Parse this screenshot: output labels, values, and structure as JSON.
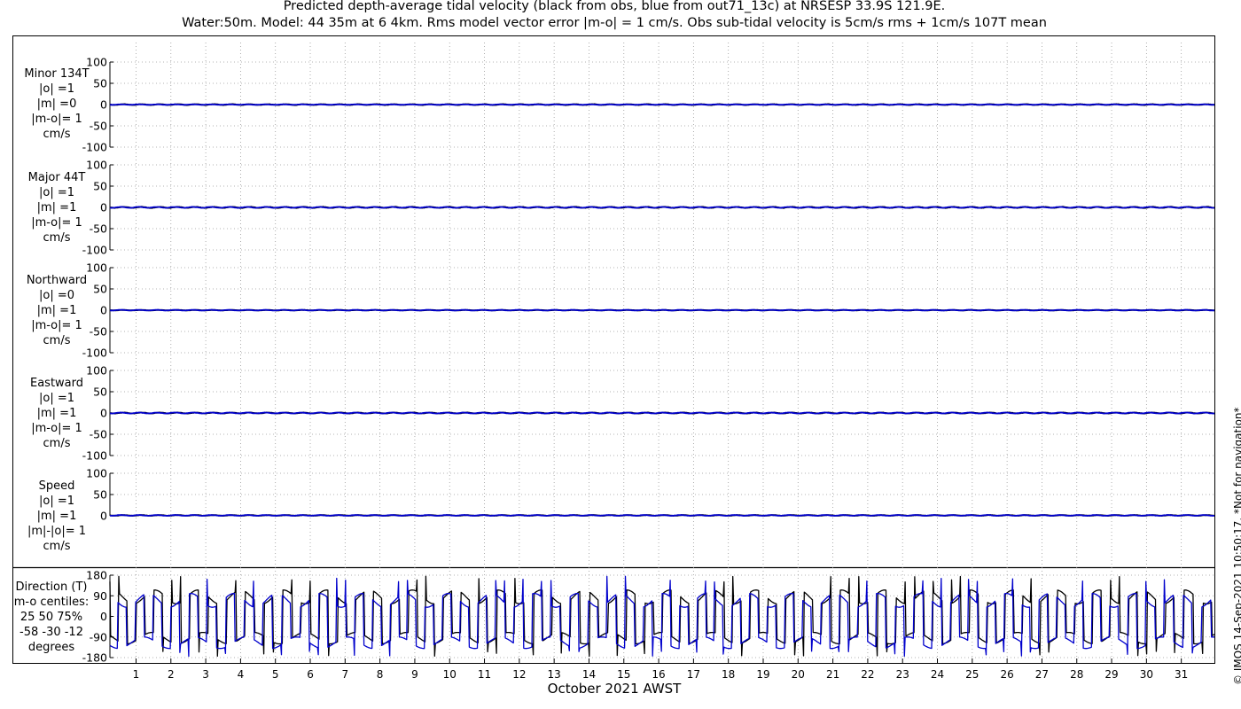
{
  "figure": {
    "title_line1": "Predicted depth-average tidal velocity (black from obs, blue from out71_13c) at NRSESP 33.9S 121.9E.",
    "title_line2": "Water:50m. Model: 44 35m at 6 4km. Rms model vector error |m-o| = 1 cm/s. Obs sub-tidal velocity is 5cm/s rms + 1cm/s 107T mean",
    "xlabel": "October 2021 AWST",
    "credit": "© IMOS 14-Sep-2021 10:50:17. *Not for navigation*",
    "colors": {
      "obs": "#000000",
      "model": "#0000cc"
    }
  },
  "panels": [
    {
      "label_lines": [
        "Minor 134T",
        "|o| =1",
        "|m| =0",
        "|m-o|= 1",
        "cm/s"
      ]
    },
    {
      "label_lines": [
        "Major 44T",
        "|o| =1",
        "|m| =1",
        "|m-o|= 1",
        "cm/s"
      ]
    },
    {
      "label_lines": [
        "Northward",
        "|o| =0",
        "|m| =1",
        "|m-o|= 1",
        "cm/s"
      ]
    },
    {
      "label_lines": [
        "Eastward",
        "|o| =1",
        "|m| =1",
        "|m-o|= 1",
        "cm/s"
      ]
    },
    {
      "label_lines": [
        "Speed",
        "|o| =1",
        "|m| =1",
        "|m|-|o|= 1",
        "cm/s"
      ]
    },
    {
      "label_lines": [
        "Direction (T)",
        "m-o centiles:",
        "25  50  75%",
        "-58 -30 -12",
        "degrees"
      ]
    }
  ],
  "chart_data": [
    {
      "type": "line",
      "title": "Minor 134T",
      "ylabel": "cm/s",
      "ylim": [
        -100,
        100
      ],
      "yticks": [
        -100,
        -50,
        0,
        50,
        100
      ],
      "xlim": [
        0.25,
        31.95
      ],
      "series": [
        {
          "name": "obs",
          "amplitude": 1.0,
          "mean": 0
        },
        {
          "name": "model",
          "amplitude": 0.5,
          "mean": 0
        }
      ]
    },
    {
      "type": "line",
      "title": "Major 44T",
      "ylabel": "cm/s",
      "ylim": [
        -100,
        100
      ],
      "yticks": [
        -100,
        -50,
        0,
        50,
        100
      ],
      "xlim": [
        0.25,
        31.95
      ],
      "series": [
        {
          "name": "obs",
          "amplitude": 1.2,
          "mean": 0
        },
        {
          "name": "model",
          "amplitude": 1.0,
          "mean": 0
        }
      ]
    },
    {
      "type": "line",
      "title": "Northward",
      "ylabel": "cm/s",
      "ylim": [
        -100,
        100
      ],
      "yticks": [
        -100,
        -50,
        0,
        50,
        100
      ],
      "xlim": [
        0.25,
        31.95
      ],
      "series": [
        {
          "name": "obs",
          "amplitude": 0.5,
          "mean": 0
        },
        {
          "name": "model",
          "amplitude": 0.8,
          "mean": 0
        }
      ]
    },
    {
      "type": "line",
      "title": "Eastward",
      "ylabel": "cm/s",
      "ylim": [
        -100,
        100
      ],
      "yticks": [
        -100,
        -50,
        0,
        50,
        100
      ],
      "xlim": [
        0.25,
        31.95
      ],
      "series": [
        {
          "name": "obs",
          "amplitude": 1.0,
          "mean": 0
        },
        {
          "name": "model",
          "amplitude": 1.0,
          "mean": 0
        }
      ]
    },
    {
      "type": "line",
      "title": "Speed",
      "ylabel": "cm/s",
      "ylim": [
        -100,
        100
      ],
      "yticks": [
        0,
        50,
        100
      ],
      "xlim": [
        0.25,
        31.95
      ],
      "series": [
        {
          "name": "obs",
          "amplitude": 0.8,
          "mean": 1
        },
        {
          "name": "model",
          "amplitude": 0.8,
          "mean": 1
        }
      ]
    },
    {
      "type": "line",
      "title": "Direction (T)",
      "ylabel": "degrees",
      "ylim": [
        -180,
        180
      ],
      "yticks": [
        -180,
        -90,
        0,
        90,
        180
      ],
      "xlim": [
        0.25,
        31.95
      ],
      "series": [
        {
          "name": "obs",
          "flood_dir": 85,
          "ebb_dir": -95
        },
        {
          "name": "model",
          "flood_dir": 70,
          "ebb_dir": -115
        }
      ]
    }
  ],
  "xaxis": {
    "ticks": [
      1,
      2,
      3,
      4,
      5,
      6,
      7,
      8,
      9,
      10,
      11,
      12,
      13,
      14,
      15,
      16,
      17,
      18,
      19,
      20,
      21,
      22,
      23,
      24,
      25,
      26,
      27,
      28,
      29,
      30,
      31
    ],
    "tick_labels": [
      "1",
      "2",
      "3",
      "4",
      "5",
      "6",
      "7",
      "8",
      "9",
      "10",
      "11",
      "12",
      "13",
      "14",
      "15",
      "16",
      "17",
      "18",
      "19",
      "20",
      "21",
      "22",
      "23",
      "24",
      "25",
      "26",
      "27",
      "28",
      "29",
      "30",
      "31"
    ]
  }
}
